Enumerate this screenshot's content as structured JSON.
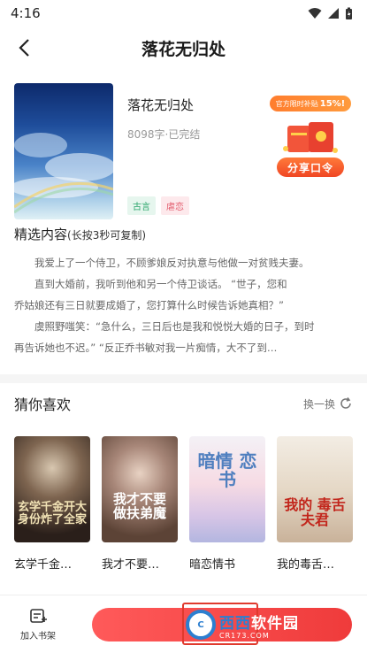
{
  "status": {
    "time": "4:16"
  },
  "nav": {
    "title": "落花无归处"
  },
  "book": {
    "title": "落花无归处",
    "meta": "8098字·已完结",
    "tags": [
      "古言",
      "虐恋"
    ]
  },
  "promo": {
    "pill_text": "官方限时补贴",
    "pill_value": "15%!",
    "button": "分享口令"
  },
  "excerpt": {
    "title": "精选内容",
    "hint": "(长按3秒可复制)",
    "paragraphs": [
      "我爱上了一个侍卫，不顾爹娘反对执意与他做一对贫贱夫妻。",
      "直到大婚前，我听到他和另一个侍卫谈话。    “世子，您和",
      "乔姑娘还有三日就要成婚了，您打算什么时候告诉她真相？”",
      "虞照野嗤笑：“急什么，三日后也是我和悦悦大婚的日子，到时",
      "再告诉她也不迟。”    “反正乔书敏对我一片痴情，大不了到…"
    ]
  },
  "guess": {
    "title": "猜你喜欢",
    "refresh": "换一换",
    "books": [
      {
        "name": "玄学千金…",
        "cover_text": "玄学千金开大 身份炸了全家"
      },
      {
        "name": "我才不要…",
        "cover_text": "我才不要 做扶弟魔"
      },
      {
        "name": "暗恋情书",
        "cover_text": "暗情 恋书"
      },
      {
        "name": "我的毒舌…",
        "cover_text": "我的 毒舌夫君"
      }
    ]
  },
  "bottom": {
    "shelf_label": "加入书架",
    "watermark_main_a": "西西",
    "watermark_main_b": "软件园",
    "watermark_sub": "CR173.COM"
  },
  "colors": {
    "accent": "#ef3b3b",
    "promo": "#f04623",
    "watermark": "#2d7fd0"
  }
}
